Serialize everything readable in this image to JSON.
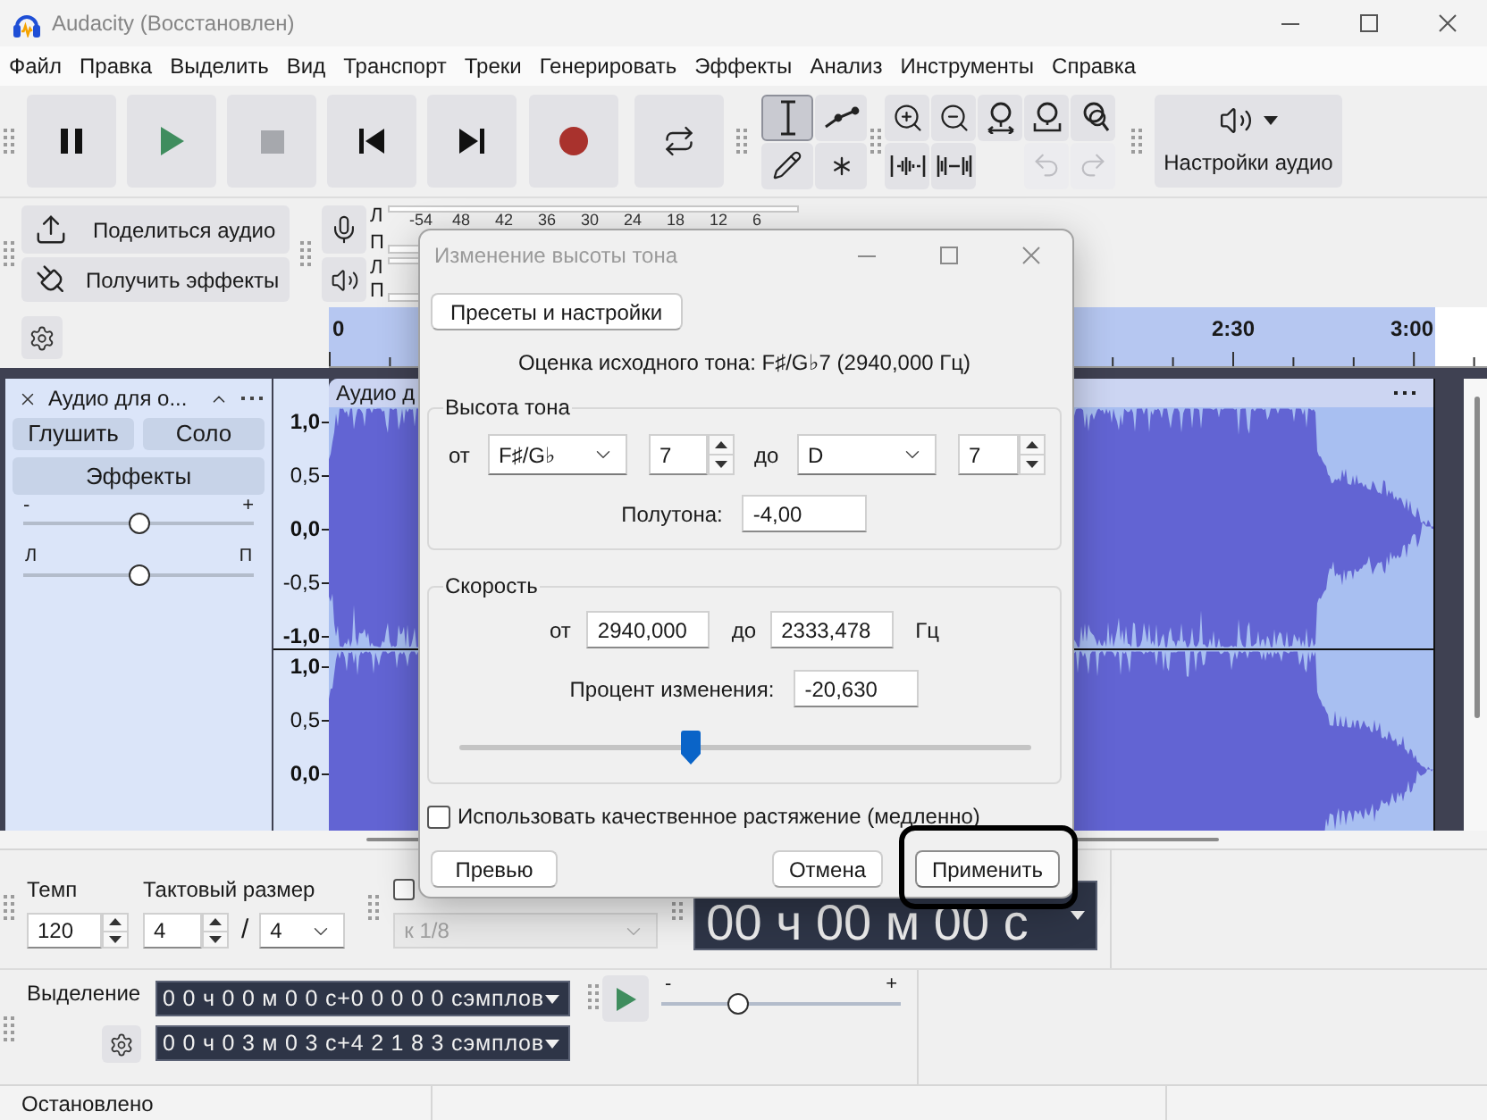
{
  "window": {
    "title": "Audacity (Восстановлен)"
  },
  "menu": [
    "Файл",
    "Правка",
    "Выделить",
    "Вид",
    "Транспорт",
    "Треки",
    "Генерировать",
    "Эффекты",
    "Анализ",
    "Инструменты",
    "Справка"
  ],
  "toolbar": {
    "tools": [
      {
        "kind": "select",
        "selected": true
      },
      {
        "kind": "envelope",
        "selected": false
      },
      {
        "kind": "draw",
        "selected": false
      },
      {
        "kind": "multi",
        "selected": false
      }
    ],
    "history": [
      {
        "kind": "undo",
        "disabled": true
      },
      {
        "kind": "redo",
        "disabled": true
      }
    ],
    "audio_settings": "Настройки аудио"
  },
  "share_toolbar": {
    "share_audio": "Поделиться аудио",
    "get_effects": "Получить эффекты"
  },
  "meters": {
    "recording": {
      "channels": [
        "Л",
        "П"
      ],
      "scale": [
        "-54",
        "48",
        "42",
        "36",
        "30",
        "24",
        "18",
        "12",
        "6"
      ]
    },
    "playback": {
      "channels": [
        "Л",
        "П"
      ]
    }
  },
  "timeline": {
    "labels": [
      "0",
      "2:30",
      "3:00"
    ]
  },
  "track": {
    "name": "Аудио для о...",
    "mute": "Глушить",
    "solo": "Соло",
    "effects": "Эффекты",
    "gain": {
      "min": "-",
      "max": "+",
      "level": 0.5
    },
    "pan": {
      "min": "Л",
      "max": "П",
      "level": 0.5
    },
    "clip_title": "Аудио д",
    "channels": [
      {
        "scale": [
          {
            "text": "1,0",
            "major": true
          },
          {
            "text": "0,5",
            "major": false
          },
          {
            "text": "0,0",
            "major": true
          },
          {
            "text": "-0,5",
            "major": false
          },
          {
            "text": "-1,0",
            "major": true
          }
        ]
      },
      {
        "scale": [
          {
            "text": "1,0",
            "major": true
          },
          {
            "text": "0,5",
            "major": false
          },
          {
            "text": "0,0",
            "major": true
          }
        ]
      }
    ]
  },
  "dialog": {
    "title": "Изменение высоты тона",
    "presets": "Пресеты и настройки",
    "estimate": "Оценка исходного тона: F♯/G♭7 (2940,000 Гц)",
    "pitch": {
      "legend": "Высота тона",
      "from_label": "от",
      "from_note": "F♯/G♭",
      "from_octave": "7",
      "to_label": "до",
      "to_note": "D",
      "to_octave": "7",
      "semitones_label": "Полутона:",
      "semitones": "-4,00"
    },
    "speed": {
      "legend": "Скорость",
      "from_label": "от",
      "from": "2940,000",
      "to_label": "до",
      "to": "2333,478",
      "unit": "Гц",
      "percent_label": "Процент изменения:",
      "percent": "-20,630",
      "level": 0.4
    },
    "high_quality": {
      "label": "Использовать качественное растяжение (медленно)",
      "checked": false
    },
    "buttons": [
      {
        "label": "Превью",
        "kind": "preview",
        "highlighted": false
      },
      {
        "label": "Отмена",
        "kind": "cancel",
        "highlighted": false
      },
      {
        "label": "Применить",
        "kind": "apply",
        "highlighted": true
      }
    ]
  },
  "bottom_toolbar": {
    "tempo": {
      "label": "Темп",
      "value": "120"
    },
    "time_signature": {
      "label": "Тактовый размер",
      "beats": "4",
      "separator": "/",
      "unit": "4"
    },
    "snap": {
      "checked": false,
      "value": "к 1/8",
      "disabled": true
    },
    "time": "00 ч 00 м 00 с",
    "selection": {
      "label": "Выделение",
      "start": "0 0 ч 0 0 м 0 0 с+0 0 0 0 0 сэмплов",
      "end": "0 0 ч 0 3 м 0 3 с+4 2 1 8 3 сэмплов"
    },
    "play_speed": {
      "min": "-",
      "max": "+",
      "level": 0.3
    }
  },
  "status_bar": {
    "text": "Остановлено"
  }
}
